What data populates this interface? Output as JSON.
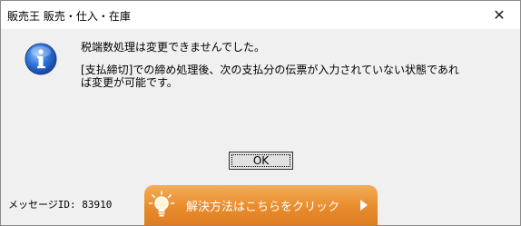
{
  "window": {
    "title": "販売王 販売・仕入・在庫",
    "close_glyph": "✕"
  },
  "message": {
    "primary": "税端数処理は変更できませんでした。",
    "secondary": "[支払締切]での締め処理後、次の支払分の伝票が入力されていない状態であれば変更が可能です。"
  },
  "buttons": {
    "ok_label": "OK",
    "solution_label": "解決方法はこちらをクリック"
  },
  "footer": {
    "message_id": "メッセージID: 83910"
  },
  "icons": {
    "info": "info-icon",
    "bulb": "lightbulb-icon",
    "play": "play-icon"
  },
  "colors": {
    "accent_orange": "#e98c2d",
    "info_blue": "#1f5fc4"
  }
}
